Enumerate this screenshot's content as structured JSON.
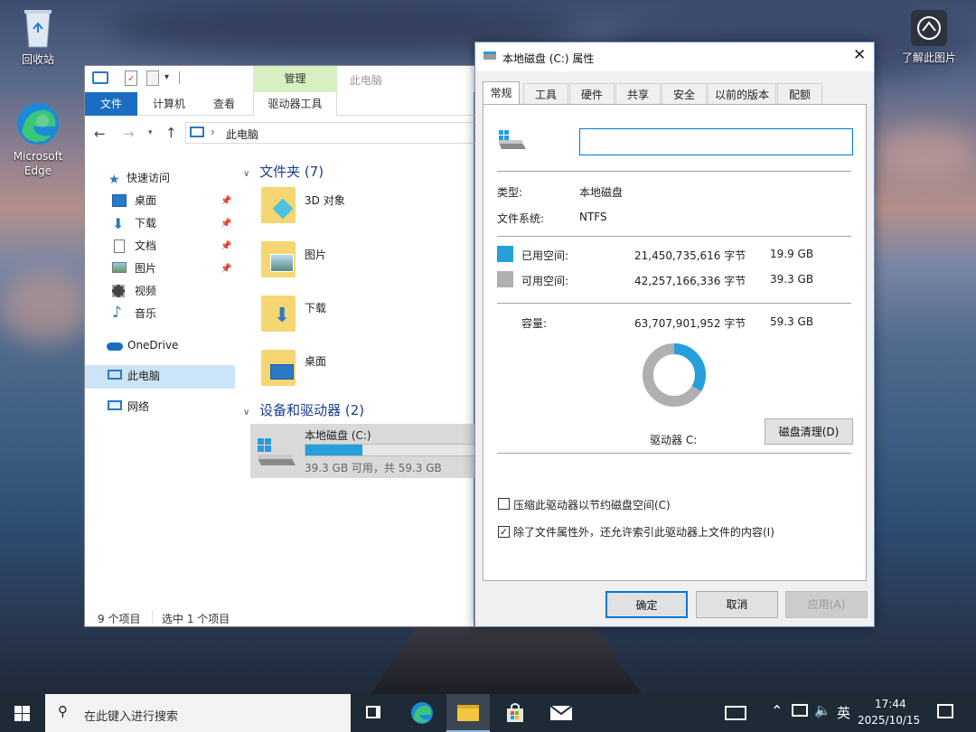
{
  "desktop": {
    "recycle_bin": "回收站",
    "edge": "Microsoft\nEdge",
    "learn_picture": "了解此图片"
  },
  "explorer": {
    "context_tab": "管理",
    "window_title": "此电脑",
    "tabs": [
      "文件",
      "计算机",
      "查看",
      "驱动器工具"
    ],
    "address": "此电脑",
    "nav": {
      "quick": "快速访问",
      "desktop": "桌面",
      "downloads": "下载",
      "documents": "文档",
      "pictures": "图片",
      "videos": "视频",
      "music": "音乐",
      "onedrive": "OneDrive",
      "thispc": "此电脑",
      "network": "网络"
    },
    "groups": {
      "folders": "文件夹 (7)",
      "devices": "设备和驱动器 (2)"
    },
    "folders": [
      "3D 对象",
      "图片",
      "下载",
      "桌面"
    ],
    "drive": {
      "name": "本地磁盘 (C:)",
      "info": "39.3 GB 可用，共 59.3 GB",
      "used_fraction": 0.335
    },
    "status": {
      "items": "9 个项目",
      "selected": "选中 1 个项目"
    }
  },
  "dialog": {
    "title": "本地磁盘 (C:) 属性",
    "tabs": [
      "常规",
      "工具",
      "硬件",
      "共享",
      "安全",
      "以前的版本",
      "配额"
    ],
    "name_value": "",
    "type_label": "类型:",
    "type_value": "本地磁盘",
    "fs_label": "文件系统:",
    "fs_value": "NTFS",
    "used_label": "已用空间:",
    "used_bytes": "21,450,735,616 字节",
    "used_gb": "19.9 GB",
    "free_label": "可用空间:",
    "free_bytes": "42,257,166,336 字节",
    "free_gb": "39.3 GB",
    "cap_label": "容量:",
    "cap_bytes": "63,707,901,952 字节",
    "cap_gb": "59.3 GB",
    "used_fraction": 0.336,
    "drive_label": "驱动器 C:",
    "cleanup": "磁盘清理(D)",
    "compress": "压缩此驱动器以节约磁盘空间(C)",
    "compress_checked": false,
    "index": "除了文件属性外，还允许索引此驱动器上文件的内容(I)",
    "index_checked": true,
    "ok": "确定",
    "cancel": "取消",
    "apply": "应用(A)",
    "colors": {
      "used": "#26a0da",
      "free": "#b0b0b0"
    }
  },
  "taskbar": {
    "search_placeholder": "在此键入进行搜索",
    "time": "17:44",
    "date": "2025/10/15",
    "ime": "英"
  }
}
